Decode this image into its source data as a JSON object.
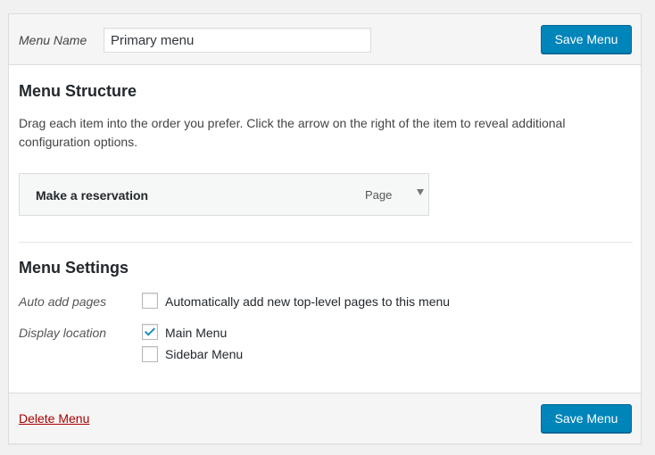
{
  "header": {
    "menu_name_label": "Menu Name",
    "menu_name_value": "Primary menu",
    "save_label": "Save Menu"
  },
  "structure": {
    "title": "Menu Structure",
    "instructions": "Drag each item into the order you prefer. Click the arrow on the right of the item to reveal additional configuration options.",
    "items": [
      {
        "title": "Make a reservation",
        "type": "Page",
        "icon": "triangle-down-icon"
      }
    ]
  },
  "settings": {
    "title": "Menu Settings",
    "auto_add": {
      "label": "Auto add pages",
      "option": "Automatically add new top-level pages to this menu",
      "checked": false
    },
    "display_location": {
      "label": "Display location",
      "options": [
        {
          "label": "Main Menu",
          "checked": true
        },
        {
          "label": "Sidebar Menu",
          "checked": false
        }
      ]
    }
  },
  "footer": {
    "delete_label": "Delete Menu",
    "save_label": "Save Menu"
  },
  "colors": {
    "primary_button": "#0085ba",
    "delete_link": "#aa0000",
    "checkmark": "#1e8cbe"
  }
}
